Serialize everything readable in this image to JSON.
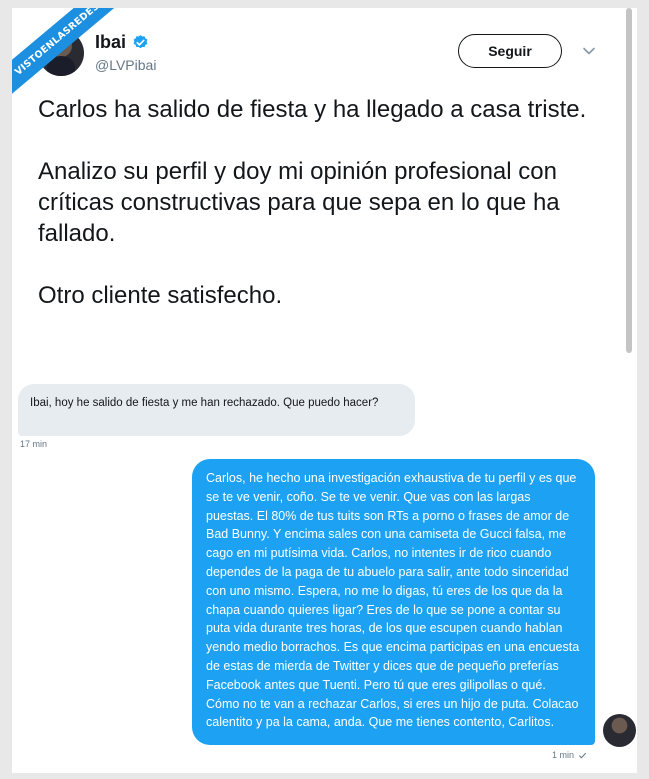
{
  "watermark": "VISTOENLASREDES",
  "tweet": {
    "author_name": "Ibai",
    "author_handle": "@LVPibai",
    "follow_label": "Seguir",
    "text": "Carlos ha salido de fiesta y ha llegado a casa triste.\n\nAnalizo su perfil y doy mi opinión profesional con críticas constructivas para que sepa en lo que ha fallado.\n\nOtro cliente satisfecho."
  },
  "chat": {
    "incoming": {
      "text": "Ibai, hoy he salido de fiesta y me han rechazado. Que puedo hacer?",
      "time": "17 min"
    },
    "outgoing": {
      "text": "Carlos, he hecho una investigación exhaustiva de tu perfil y es que se te ve venir, coño. Se te ve venir. Que vas con las largas puestas. El 80% de tus tuits son RTs a porno o frases de amor de Bad Bunny. Y encima sales con una camiseta de Gucci falsa, me cago en mi putísima vida. Carlos, no intentes ir de rico cuando dependes de la paga de tu abuelo para salir, ante todo sinceridad con uno mismo. Espera, no me lo digas, tú eres de los que da la chapa cuando quieres ligar? Eres de lo que se pone a contar su puta vida durante tres horas, de los que escupen cuando hablan yendo medio borrachos. Es que encima participas en una encuesta de estas de mierda de Twitter y dices que de pequeño preferías Facebook antes que Tuenti. Pero tú que eres gilipollas o qué. Cómo no te van a rechazar Carlos, si eres un hijo de puta. Colacao calentito y pa la cama, anda. Que me tienes contento, Carlitos.",
      "time": "1 min",
      "status_icon": "check-icon"
    }
  },
  "colors": {
    "accent": "#1da1f2",
    "banner": "#1d8fe0",
    "incoming_bubble": "#e6ecf0"
  }
}
